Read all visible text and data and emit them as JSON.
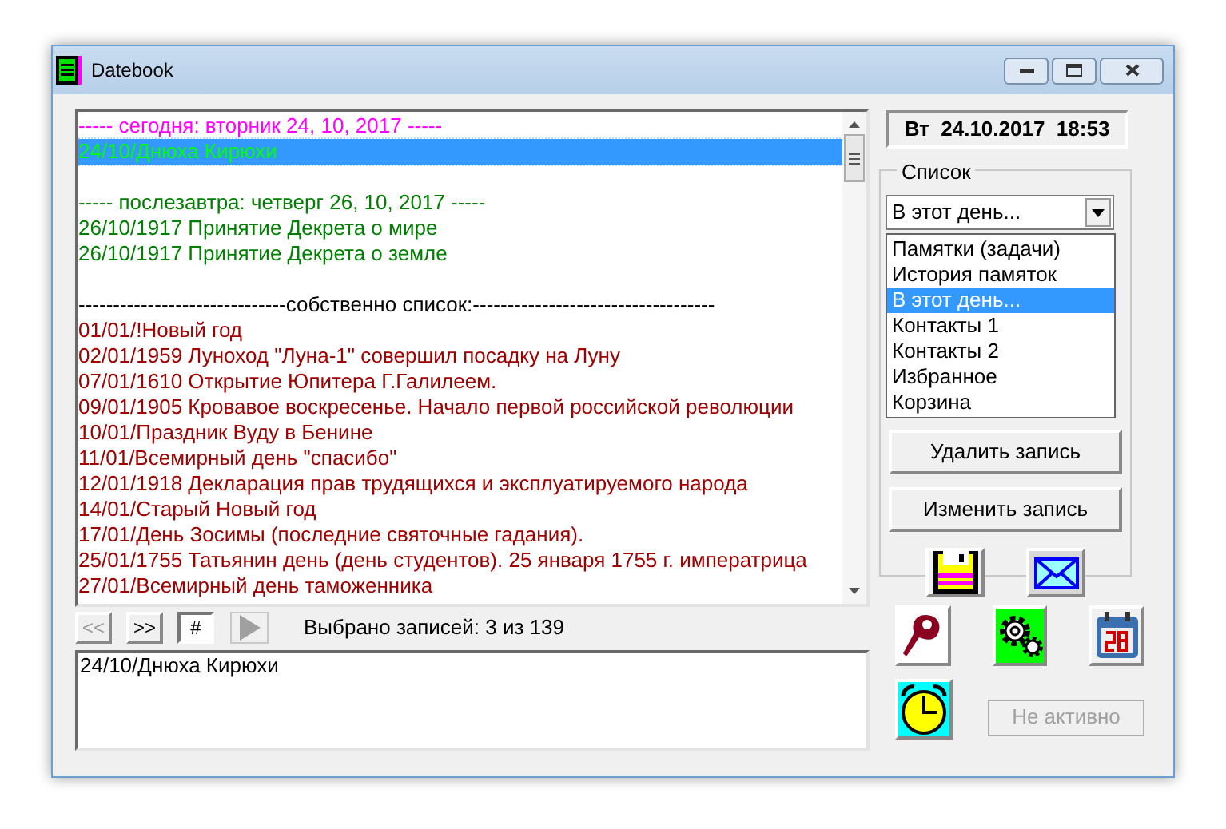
{
  "window": {
    "title": "Datebook"
  },
  "list": {
    "rows": [
      {
        "kind": "today_header",
        "text": "----- сегодня: вторник 24, 10, 2017 -----",
        "selected": false
      },
      {
        "kind": "today_entry",
        "text": "24/10/Днюха Кирюхи",
        "selected": true
      },
      {
        "kind": "blank",
        "selected": false
      },
      {
        "kind": "upcoming_header",
        "text": "----- послезавтра: четверг 26, 10, 2017 -----",
        "selected": false
      },
      {
        "kind": "upcoming_entry",
        "text": "26/10/1917 Принятие Декрета о мире",
        "selected": false
      },
      {
        "kind": "upcoming_entry",
        "text": "26/10/1917 Принятие Декрета о земле",
        "selected": false
      },
      {
        "kind": "blank",
        "selected": false
      },
      {
        "kind": "separator",
        "text": "------------------------------собственно список:-----------------------------------",
        "selected": false
      },
      {
        "kind": "entry",
        "text": "01/01/!Новый год",
        "selected": false
      },
      {
        "kind": "entry",
        "text": "02/01/1959 Луноход \"Луна-1\" совершил посадку на Луну",
        "selected": false
      },
      {
        "kind": "entry",
        "text": "07/01/1610 Открытие Юпитера Г.Галилеем.",
        "selected": false
      },
      {
        "kind": "entry",
        "text": "09/01/1905 Кровавое воскресенье. Начало первой российской революции",
        "selected": false
      },
      {
        "kind": "entry",
        "text": "10/01/Праздник Вуду в Бенине",
        "selected": false
      },
      {
        "kind": "entry",
        "text": "11/01/Всемирный день \"спасибо\"",
        "selected": false
      },
      {
        "kind": "entry",
        "text": "12/01/1918 Декларация прав трудящихся и эксплуатируемого народа",
        "selected": false
      },
      {
        "kind": "entry",
        "text": "14/01/Старый Новый год",
        "selected": false
      },
      {
        "kind": "entry",
        "text": "17/01/День Зосимы (последние святочные гадания).",
        "selected": false
      },
      {
        "kind": "entry",
        "text": "25/01/1755 Татьянин день (день студентов). 25 января 1755 г. императрица",
        "selected": false
      },
      {
        "kind": "entry",
        "text": "27/01/Всемирный день таможенника",
        "selected": false
      }
    ]
  },
  "nav": {
    "buttons": [
      {
        "label": "<<",
        "disabled": true,
        "pressed": false
      },
      {
        "label": ">>",
        "disabled": false,
        "pressed": false
      },
      {
        "label": "#",
        "disabled": false,
        "pressed": true
      }
    ],
    "play_disabled": true,
    "status": "Выбрано записей: 3 из 139"
  },
  "memo": {
    "value": "24/10/Днюха Кирюхи"
  },
  "clock": "Вт  24.10.2017  18:53",
  "group": {
    "title": "Список",
    "dropdown": {
      "value": "В этот день...",
      "expanded": true,
      "options": [
        {
          "label": "Памятки (задачи)",
          "selected": false
        },
        {
          "label": "История памяток",
          "selected": false
        },
        {
          "label": "В этот день...",
          "selected": true
        },
        {
          "label": "Контакты 1",
          "selected": false
        },
        {
          "label": "Контакты 2",
          "selected": false
        },
        {
          "label": "Избранное",
          "selected": false
        },
        {
          "label": "Корзина",
          "selected": false
        }
      ]
    },
    "buttons": [
      "Удалить запись",
      "Изменить запись"
    ]
  },
  "status_field": {
    "value": "Не активно",
    "disabled": true
  }
}
